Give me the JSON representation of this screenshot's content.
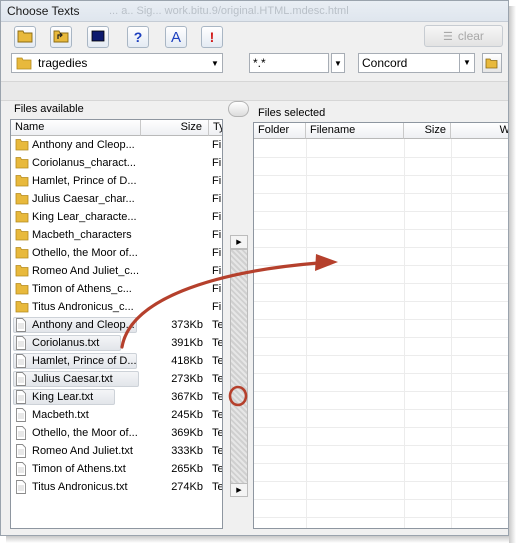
{
  "window": {
    "title": "Choose Texts",
    "title_ghost": "... a.. Sig... work.bitu.9/original.HTML.mdesc.html"
  },
  "toolbar": {
    "buttons": [
      {
        "name": "open-folder-button",
        "icon": "folder-icon",
        "glyph": ""
      },
      {
        "name": "parent-folder-button",
        "icon": "folder-up-icon",
        "glyph": ""
      },
      {
        "name": "display-button",
        "icon": "monitor-icon",
        "glyph": ""
      },
      {
        "name": "help-button",
        "icon": "help-icon",
        "glyph": "?"
      },
      {
        "name": "font-button",
        "icon": "font-icon",
        "glyph": "A"
      },
      {
        "name": "alert-button",
        "icon": "alert-icon",
        "glyph": "!"
      }
    ],
    "clear_label": "clear"
  },
  "filters": {
    "folder_value": "tragedies",
    "mask_value": "*.*",
    "mode_value": "Concord"
  },
  "left_panel": {
    "label": "Files available",
    "columns": [
      "Name",
      "Size",
      "Ty"
    ],
    "rows": [
      {
        "name": "Anthony and Cleop...",
        "size": "",
        "type": "Fi",
        "kind": "folder",
        "selected": false
      },
      {
        "name": "Coriolanus_charact...",
        "size": "",
        "type": "Fi",
        "kind": "folder",
        "selected": false
      },
      {
        "name": "Hamlet, Prince of D...",
        "size": "",
        "type": "Fi",
        "kind": "folder",
        "selected": false
      },
      {
        "name": "Julius Caesar_char...",
        "size": "",
        "type": "Fi",
        "kind": "folder",
        "selected": false
      },
      {
        "name": "King Lear_characte...",
        "size": "",
        "type": "Fi",
        "kind": "folder",
        "selected": false
      },
      {
        "name": "Macbeth_characters",
        "size": "",
        "type": "Fi",
        "kind": "folder",
        "selected": false
      },
      {
        "name": "Othello, the Moor of...",
        "size": "",
        "type": "Fi",
        "kind": "folder",
        "selected": false
      },
      {
        "name": "Romeo And Juliet_c...",
        "size": "",
        "type": "Fi",
        "kind": "folder",
        "selected": false
      },
      {
        "name": "Timon of Athens_c...",
        "size": "",
        "type": "Fi",
        "kind": "folder",
        "selected": false
      },
      {
        "name": "Titus Andronicus_c...",
        "size": "",
        "type": "Fi",
        "kind": "folder",
        "selected": false
      },
      {
        "name": "Anthony and Cleop...",
        "size": "373Kb",
        "type": "Te",
        "kind": "file",
        "selected": true
      },
      {
        "name": "Coriolanus.txt",
        "size": "391Kb",
        "type": "Te",
        "kind": "file",
        "selected": true
      },
      {
        "name": "Hamlet, Prince of D...",
        "size": "418Kb",
        "type": "Te",
        "kind": "file",
        "selected": true
      },
      {
        "name": "Julius Caesar.txt",
        "size": "273Kb",
        "type": "Te",
        "kind": "file",
        "selected": true
      },
      {
        "name": "King Lear.txt",
        "size": "367Kb",
        "type": "Te",
        "kind": "file",
        "selected": true
      },
      {
        "name": "Macbeth.txt",
        "size": "245Kb",
        "type": "Te",
        "kind": "file",
        "selected": false
      },
      {
        "name": "Othello, the Moor of...",
        "size": "369Kb",
        "type": "Te",
        "kind": "file",
        "selected": false
      },
      {
        "name": "Romeo And Juliet.txt",
        "size": "333Kb",
        "type": "Te",
        "kind": "file",
        "selected": false
      },
      {
        "name": "Timon of Athens.txt",
        "size": "265Kb",
        "type": "Te",
        "kind": "file",
        "selected": false
      },
      {
        "name": "Titus Andronicus.txt",
        "size": "274Kb",
        "type": "Te",
        "kind": "file",
        "selected": false
      }
    ]
  },
  "right_panel": {
    "label": "Files selected",
    "columns": [
      "Folder",
      "Filename",
      "Size",
      "W"
    ]
  },
  "annotation": {
    "arrow_color": "#b5402c"
  },
  "colors": {
    "folder": "#e8b93c",
    "alert": "#d11a1a",
    "help": "#1c3fbf"
  }
}
